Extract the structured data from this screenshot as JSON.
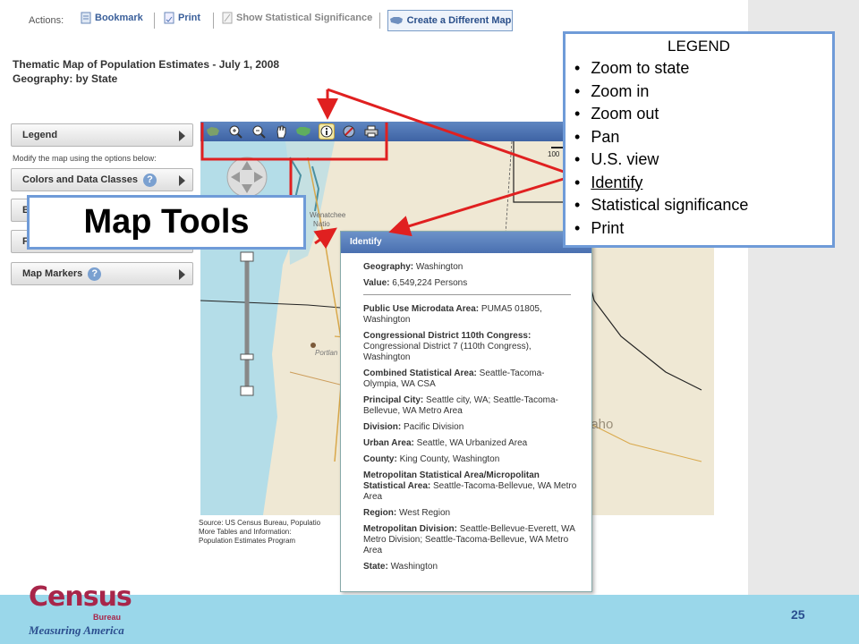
{
  "actions": {
    "label": "Actions:",
    "bookmark": "Bookmark",
    "print": "Print",
    "show_significance": "Show Statistical Significance",
    "create_map": "Create a Different Map"
  },
  "title": {
    "line1": "Thematic Map of Population Estimates - July 1, 2008",
    "line2": "Geography: by State"
  },
  "left_panel": {
    "legend": "Legend",
    "note": "Modify the map using the options below:",
    "colors": "Colors and Data Classes",
    "b_partial": "B",
    "f_partial": "F",
    "map_markers": "Map Markers",
    "help_glyph": "?"
  },
  "map": {
    "scale_label": "100",
    "wenatchee": "Wenatchee",
    "natl": "Natio",
    "portland": "Portlan",
    "idaho": "daho"
  },
  "source": {
    "line1": "Source: US Census Bureau, Populatio",
    "line2": "More Tables and Information:",
    "line3": "Population Estimates Program"
  },
  "identify": {
    "title": "Identify",
    "rows": [
      {
        "k": "Geography:",
        "v": "Washington"
      },
      {
        "k": "Value:",
        "v": "6,549,224 Persons"
      }
    ],
    "details": [
      {
        "k": "Public Use Microdata Area:",
        "v": "PUMA5 01805, Washington"
      },
      {
        "k": "Congressional District 110th Congress:",
        "v": "Congressional District 7 (110th Congress), Washington"
      },
      {
        "k": "Combined Statistical Area:",
        "v": "Seattle-Tacoma-Olympia, WA CSA"
      },
      {
        "k": "Principal City:",
        "v": "Seattle city, WA; Seattle-Tacoma-Bellevue, WA Metro Area"
      },
      {
        "k": "Division:",
        "v": "Pacific Division"
      },
      {
        "k": "Urban Area:",
        "v": "Seattle, WA Urbanized Area"
      },
      {
        "k": "County:",
        "v": "King County, Washington"
      },
      {
        "k": "Metropolitan Statistical Area/Micropolitan Statistical Area:",
        "v": "Seattle-Tacoma-Bellevue, WA Metro Area"
      },
      {
        "k": "Region:",
        "v": "West Region"
      },
      {
        "k": "Metropolitan Division:",
        "v": "Seattle-Bellevue-Everett, WA Metro Division; Seattle-Tacoma-Bellevue, WA Metro Area"
      },
      {
        "k": "State:",
        "v": "Washington"
      }
    ]
  },
  "legend": {
    "title": "LEGEND",
    "items": [
      "Zoom to state",
      "Zoom in",
      "Zoom out",
      "Pan",
      "U.S. view",
      "Identify",
      "Statistical significance",
      "Print"
    ]
  },
  "callout": {
    "text": "Map Tools"
  },
  "footer": {
    "census": "Census",
    "bureau": "Bureau",
    "measuring": "Measuring America",
    "page": "25"
  },
  "colors": {
    "accent_red": "#e02020",
    "callout_border": "#6f9bd8",
    "toolbar_blue": "#4a70b0",
    "footer_bg": "#9ad7ea",
    "census_red": "#a8264a"
  }
}
